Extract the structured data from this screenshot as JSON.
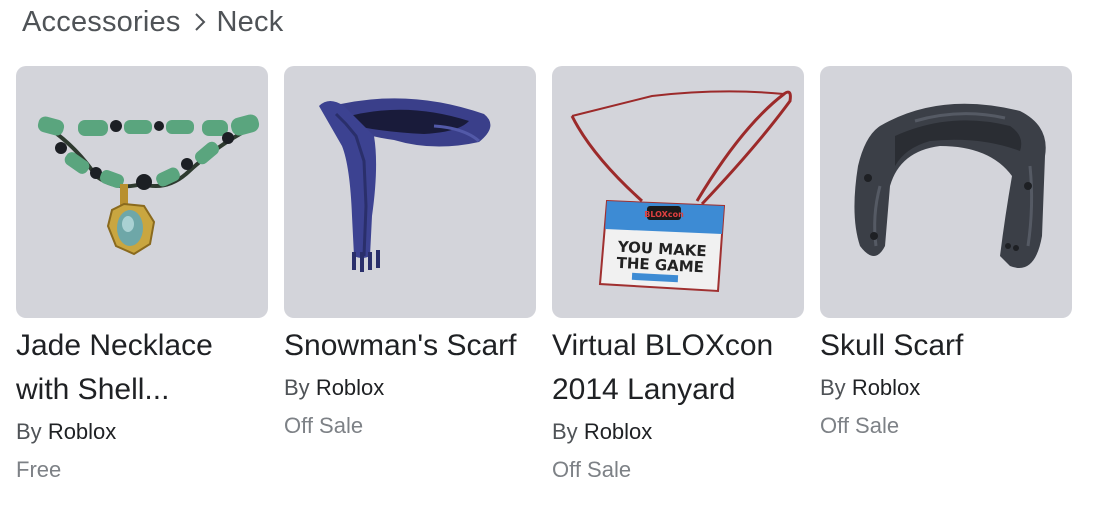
{
  "breadcrumb": {
    "parent": "Accessories",
    "current": "Neck"
  },
  "items": [
    {
      "name": "Jade Necklace with Shell...",
      "by_prefix": "By",
      "creator": "Roblox",
      "price": "Free",
      "icon": "jade-necklace-icon"
    },
    {
      "name": "Snowman's Scarf",
      "by_prefix": "By",
      "creator": "Roblox",
      "price": "Off Sale",
      "icon": "blue-scarf-icon"
    },
    {
      "name": "Virtual BLOXcon 2014 Lanyard",
      "by_prefix": "By",
      "creator": "Roblox",
      "price": "Off Sale",
      "icon": "lanyard-icon",
      "badge_text": [
        "YOU MAKE",
        "THE GAME"
      ]
    },
    {
      "name": "Skull Scarf",
      "by_prefix": "By",
      "creator": "Roblox",
      "price": "Off Sale",
      "icon": "skull-scarf-icon"
    }
  ],
  "colors": {
    "thumb_bg": "#d3d4da",
    "price_text": "#7d8186"
  }
}
